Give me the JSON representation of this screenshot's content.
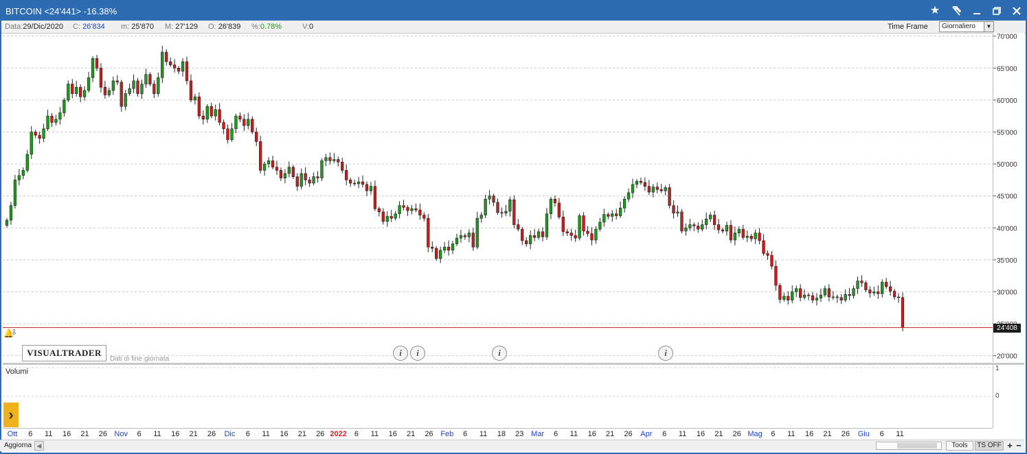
{
  "window": {
    "title": "BITCOIN <24'441> -16.38%",
    "controls": [
      "star-icon",
      "pin-icon",
      "minimize-icon",
      "maximize-icon",
      "close-icon"
    ]
  },
  "info": {
    "data_label": "Data:",
    "data_value": "29/Dic/2020",
    "c_label": "C:",
    "c_value": "26'834",
    "m_label": "m:",
    "m_value": "25'870",
    "M_label": "M:",
    "M_value": "27'129",
    "o_label": "O:",
    "o_value": "26'839",
    "pct_label": "%:",
    "pct_value": "0.78%",
    "v_label": "V:",
    "v_value": "0",
    "time_frame_label": "Time Frame",
    "time_frame_value": "Giornaliero"
  },
  "logo": "VISUALTRADER",
  "eod_note": "Dati di fine giornata",
  "volumes_label": "Volumi",
  "volume_ticks": [
    "1",
    "0"
  ],
  "last_price_tag": "24'408",
  "bottom": {
    "aggiorna": "Aggiorna",
    "tools": "Tools",
    "ts_off": "TS OFF",
    "plus": "+",
    "minus": "−"
  },
  "colors": {
    "up": "#1f9a1f",
    "down": "#c81e1e",
    "title_bar": "#2d6bb2",
    "price_line": "#c81e1e"
  },
  "chart_data": {
    "type": "candlestick",
    "title": "BITCOIN",
    "ylim": [
      19000,
      70500
    ],
    "y_ticks": [
      "70'000",
      "65'000",
      "60'000",
      "55'000",
      "50'000",
      "45'000",
      "40'000",
      "35'000",
      "30'000",
      "25'000",
      "20'000"
    ],
    "y_tick_values": [
      70000,
      65000,
      60000,
      55000,
      50000,
      45000,
      40000,
      35000,
      30000,
      25000,
      20000
    ],
    "x_labels": [
      {
        "text": "Ott",
        "kind": "month"
      },
      {
        "text": "6",
        "kind": "day"
      },
      {
        "text": "11",
        "kind": "day"
      },
      {
        "text": "16",
        "kind": "day"
      },
      {
        "text": "21",
        "kind": "day"
      },
      {
        "text": "26",
        "kind": "day"
      },
      {
        "text": "Nov",
        "kind": "month"
      },
      {
        "text": "6",
        "kind": "day"
      },
      {
        "text": "11",
        "kind": "day"
      },
      {
        "text": "16",
        "kind": "day"
      },
      {
        "text": "21",
        "kind": "day"
      },
      {
        "text": "26",
        "kind": "day"
      },
      {
        "text": "Dic",
        "kind": "month"
      },
      {
        "text": "6",
        "kind": "day"
      },
      {
        "text": "11",
        "kind": "day"
      },
      {
        "text": "16",
        "kind": "day"
      },
      {
        "text": "21",
        "kind": "day"
      },
      {
        "text": "26",
        "kind": "day"
      },
      {
        "text": "2022",
        "kind": "year"
      },
      {
        "text": "6",
        "kind": "day"
      },
      {
        "text": "11",
        "kind": "day"
      },
      {
        "text": "16",
        "kind": "day"
      },
      {
        "text": "21",
        "kind": "day"
      },
      {
        "text": "26",
        "kind": "day"
      },
      {
        "text": "Feb",
        "kind": "month"
      },
      {
        "text": "6",
        "kind": "day"
      },
      {
        "text": "11",
        "kind": "day"
      },
      {
        "text": "18",
        "kind": "day"
      },
      {
        "text": "23",
        "kind": "day"
      },
      {
        "text": "Mar",
        "kind": "month"
      },
      {
        "text": "6",
        "kind": "day"
      },
      {
        "text": "11",
        "kind": "day"
      },
      {
        "text": "16",
        "kind": "day"
      },
      {
        "text": "21",
        "kind": "day"
      },
      {
        "text": "26",
        "kind": "day"
      },
      {
        "text": "Apr",
        "kind": "month"
      },
      {
        "text": "6",
        "kind": "day"
      },
      {
        "text": "11",
        "kind": "day"
      },
      {
        "text": "16",
        "kind": "day"
      },
      {
        "text": "21",
        "kind": "day"
      },
      {
        "text": "26",
        "kind": "day"
      },
      {
        "text": "Mag",
        "kind": "month"
      },
      {
        "text": "6",
        "kind": "day"
      },
      {
        "text": "11",
        "kind": "day"
      },
      {
        "text": "16",
        "kind": "day"
      },
      {
        "text": "21",
        "kind": "day"
      },
      {
        "text": "26",
        "kind": "day"
      },
      {
        "text": "Giu",
        "kind": "month"
      },
      {
        "text": "6",
        "kind": "day"
      },
      {
        "text": "11",
        "kind": "day"
      }
    ],
    "closes": [
      41200,
      43500,
      47500,
      48200,
      49000,
      51500,
      55000,
      54500,
      54000,
      55500,
      57500,
      56500,
      57000,
      58000,
      60000,
      62500,
      61000,
      62000,
      60500,
      61500,
      63500,
      66500,
      65000,
      62000,
      60800,
      61500,
      63000,
      62800,
      59000,
      61000,
      61800,
      63000,
      61000,
      62500,
      64000,
      62500,
      61000,
      63500,
      67500,
      66000,
      65500,
      65000,
      64500,
      66000,
      63000,
      60000,
      60500,
      57500,
      57000,
      59000,
      57500,
      58500,
      56500,
      55500,
      53800,
      55500,
      57500,
      57000,
      56000,
      57000,
      55000,
      53500,
      49000,
      50000,
      50500,
      49500,
      49000,
      47800,
      48500,
      49500,
      48000,
      46500,
      48500,
      47500,
      47000,
      48000,
      47800,
      50500,
      51000,
      50500,
      50700,
      50300,
      49000,
      47500,
      47000,
      46900,
      47200,
      46800,
      45800,
      46500,
      43000,
      42500,
      41000,
      41800,
      41500,
      42200,
      43500,
      43200,
      42700,
      43000,
      42800,
      42000,
      41500,
      37000,
      36800,
      35200,
      36500,
      37000,
      36500,
      37500,
      38400,
      38800,
      38600,
      39200,
      37000,
      41500,
      42000,
      44500,
      45000,
      44000,
      42400,
      42300,
      42600,
      44400,
      40500,
      39800,
      38000,
      37500,
      38800,
      38500,
      39400,
      38600,
      42200,
      44500,
      43900,
      41700,
      39400,
      39200,
      38800,
      38400,
      41900,
      39500,
      39100,
      38100,
      39800,
      40900,
      42100,
      41800,
      42200,
      41900,
      43100,
      44500,
      45500,
      46800,
      47300,
      47100,
      46500,
      45600,
      46400,
      46000,
      45800,
      46300,
      43500,
      42300,
      42500,
      39500,
      40000,
      40500,
      40300,
      39800,
      40500,
      41400,
      42000,
      40500,
      39700,
      39500,
      40400,
      38100,
      39200,
      39800,
      38500,
      38700,
      38300,
      39200,
      38000,
      36000,
      35700,
      34000,
      31000,
      28800,
      29300,
      28700,
      30000,
      30500,
      29100,
      29500,
      29400,
      28700,
      29000,
      29500,
      30500,
      29200,
      29200,
      29100,
      28700,
      29600,
      29400,
      30500,
      31700,
      31400,
      30300,
      29800,
      30000,
      29700,
      31500,
      30800,
      30100,
      29200,
      29100,
      24408
    ]
  }
}
